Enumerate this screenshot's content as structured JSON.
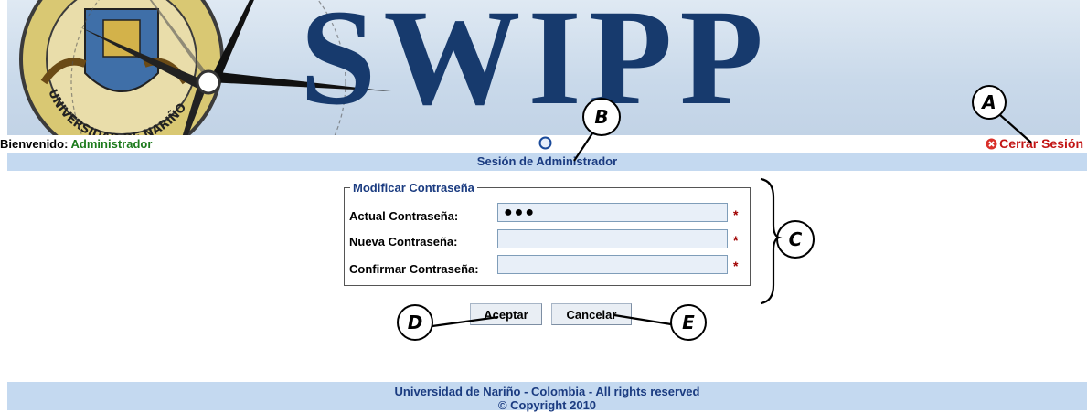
{
  "banner": {
    "title": "SWIPP",
    "emblem_text": "UNIVERSIDAD DE NARIÑO"
  },
  "welcome": {
    "label": "Bienvenido:",
    "user": "Administrador"
  },
  "header": {
    "home_icon": "home-circle-icon",
    "logout_label": "Cerrar Sesión",
    "logout_icon": "close-circle-icon"
  },
  "session_bar": {
    "title": "Sesión de Administrador"
  },
  "form": {
    "legend": "Modificar Contraseña",
    "fields": [
      {
        "label": "Actual Contraseña:",
        "value": "●●●",
        "required": "*"
      },
      {
        "label": "Nueva Contraseña:",
        "value": "",
        "required": "*"
      },
      {
        "label": "Confirmar Contraseña:",
        "value": "",
        "required": "*"
      }
    ],
    "accept_label": "Aceptar",
    "cancel_label": "Cancelar"
  },
  "footer": {
    "line1": "Universidad de Nariño - Colombia - All rights reserved",
    "line2": "© Copyright 2010"
  },
  "callouts": {
    "a": "A",
    "b": "B",
    "c": "C",
    "d": "D",
    "e": "E"
  },
  "colors": {
    "bar_bg": "#c4d9f0",
    "heading_blue": "#1a3b80",
    "user_green": "#1c7a1c",
    "logout_red": "#c21515",
    "required_red": "#a00000",
    "banner_title": "#173a6d"
  }
}
